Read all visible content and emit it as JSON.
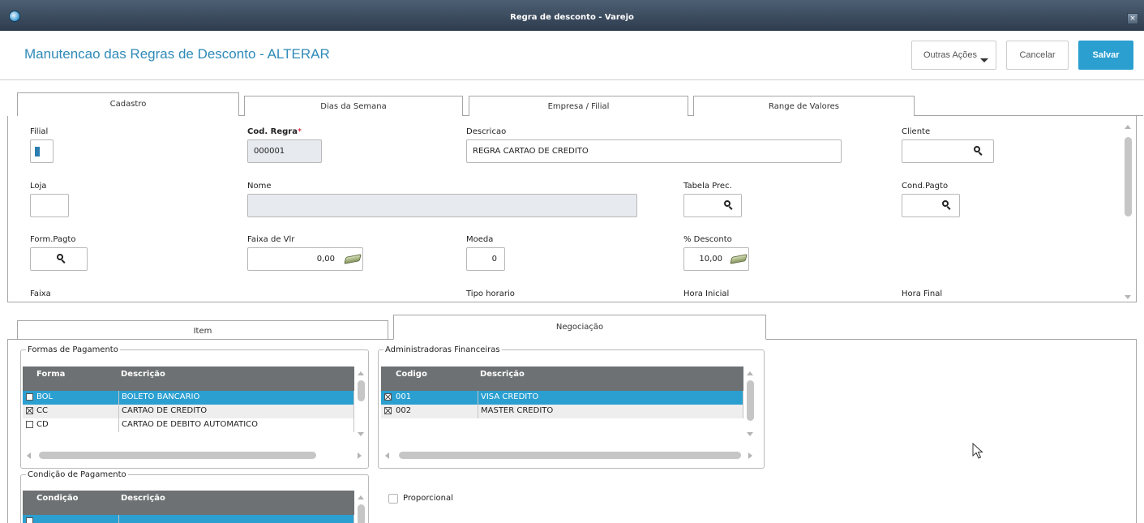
{
  "window": {
    "title": "Regra de desconto - Varejo",
    "close_symbol": "×"
  },
  "header": {
    "title": "Manutencao das Regras de Desconto - ALTERAR",
    "more_actions": "Outras Ações",
    "cancel": "Cancelar",
    "save": "Salvar",
    "accent": "#2a9fd0"
  },
  "top_tabs": [
    "Cadastro",
    "Dias da Semana",
    "Empresa / Filial",
    "Range de Valores"
  ],
  "form": {
    "filial": {
      "label": "Filial",
      "value": ""
    },
    "cod_regra": {
      "label": "Cod. Regra",
      "required_mark": "*",
      "value": "000001"
    },
    "descricao": {
      "label": "Descricao",
      "value": "REGRA CARTAO DE CREDITO"
    },
    "cliente": {
      "label": "Cliente",
      "value": ""
    },
    "loja": {
      "label": "Loja",
      "value": ""
    },
    "nome": {
      "label": "Nome",
      "value": ""
    },
    "tabela_prec": {
      "label": "Tabela Prec.",
      "value": ""
    },
    "cond_pagto": {
      "label": "Cond.Pagto",
      "value": ""
    },
    "form_pagto": {
      "label": "Form.Pagto",
      "value": ""
    },
    "faixa_vlr": {
      "label": "Faixa de Vlr",
      "value": "0,00"
    },
    "moeda": {
      "label": "Moeda",
      "value": "0"
    },
    "desconto": {
      "label": "% Desconto",
      "value": "10,00"
    },
    "faixa": {
      "label": "Faixa"
    },
    "tipo_horario": {
      "label": "Tipo horario"
    },
    "hora_inicial": {
      "label": "Hora Inicial"
    },
    "hora_final": {
      "label": "Hora Final"
    }
  },
  "lower_tabs": [
    "Item",
    "Negociação"
  ],
  "formas_pagamento": {
    "legend": "Formas de Pagamento",
    "columns": [
      "Forma",
      "Descrição"
    ],
    "rows": [
      {
        "checked": false,
        "selected": true,
        "code": "BOL",
        "desc": "BOLETO BANCARIO"
      },
      {
        "checked": true,
        "selected": false,
        "code": "CC",
        "desc": "CARTAO DE CREDITO"
      },
      {
        "checked": false,
        "selected": false,
        "code": "CD",
        "desc": "CARTAO DE DEBITO AUTOMATICO"
      }
    ]
  },
  "administradoras": {
    "legend": "Administradoras Financeiras",
    "columns": [
      "Codigo",
      "Descrição"
    ],
    "rows": [
      {
        "checked": true,
        "selected": true,
        "code": "001",
        "desc": "VISA CREDITO"
      },
      {
        "checked": true,
        "selected": false,
        "code": "002",
        "desc": "MASTER CREDITO"
      }
    ]
  },
  "condicao_pagamento": {
    "legend": "Condição de Pagamento",
    "columns": [
      "Condição",
      "Descrição"
    ],
    "rows": [
      {
        "checked": false,
        "selected": true,
        "code": "",
        "desc": ""
      }
    ]
  },
  "proporcional": {
    "label": "Proporcional",
    "checked": false
  }
}
